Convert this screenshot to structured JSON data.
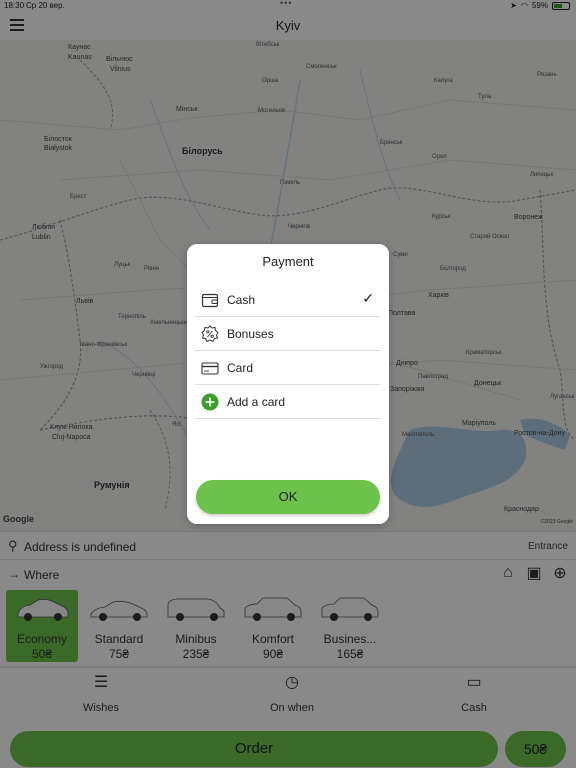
{
  "status_bar": {
    "time": "18:30",
    "date": "Ср 20 вер.",
    "battery": "59%"
  },
  "header": {
    "title": "Kyiv"
  },
  "map": {
    "labels": [
      {
        "t": "Каунас",
        "c": "mid"
      },
      {
        "t": "Kaunas",
        "c": "mid"
      },
      {
        "t": "Вільнюс",
        "c": "mid"
      },
      {
        "t": "Vilnius",
        "c": "mid"
      },
      {
        "t": "Вітебськ",
        "c": ""
      },
      {
        "t": "Смоленськ",
        "c": ""
      },
      {
        "t": "Калуга",
        "c": ""
      },
      {
        "t": "Рязань",
        "c": ""
      },
      {
        "t": "Орша",
        "c": ""
      },
      {
        "t": "Тула",
        "c": ""
      },
      {
        "t": "Мінськ",
        "c": "mid"
      },
      {
        "t": "Могильов",
        "c": ""
      },
      {
        "t": "Брянськ",
        "c": ""
      },
      {
        "t": "Білосток",
        "c": "mid"
      },
      {
        "t": "Białystok",
        "c": "mid"
      },
      {
        "t": "Білорусь",
        "c": "big"
      },
      {
        "t": "Орел",
        "c": ""
      },
      {
        "t": "Липецьк",
        "c": ""
      },
      {
        "t": "Гомель",
        "c": ""
      },
      {
        "t": "Брест",
        "c": ""
      },
      {
        "t": "Курськ",
        "c": ""
      },
      {
        "t": "Воронеж",
        "c": "mid"
      },
      {
        "t": "Люблін",
        "c": "mid"
      },
      {
        "t": "Lublin",
        "c": "mid"
      },
      {
        "t": "Чернігів",
        "c": ""
      },
      {
        "t": "Старий Оскол",
        "c": ""
      },
      {
        "t": "Суми",
        "c": ""
      },
      {
        "t": "Бєлгород",
        "c": ""
      },
      {
        "t": "Харків",
        "c": "mid"
      },
      {
        "t": "Луцьк",
        "c": ""
      },
      {
        "t": "Рівне",
        "c": ""
      },
      {
        "t": "Львів",
        "c": "mid"
      },
      {
        "t": "Полтава",
        "c": "mid"
      },
      {
        "t": "Тернопіль",
        "c": ""
      },
      {
        "t": "Хмельницький",
        "c": ""
      },
      {
        "t": "Краматорськ",
        "c": ""
      },
      {
        "t": "Дніпро",
        "c": "mid"
      },
      {
        "t": "Донецьк",
        "c": "mid"
      },
      {
        "t": "Запоріжжя",
        "c": "mid"
      },
      {
        "t": "Павлоград",
        "c": ""
      },
      {
        "t": "Луганськ",
        "c": ""
      },
      {
        "t": "Клуж-Напока",
        "c": "mid"
      },
      {
        "t": "Cluj-Napoca",
        "c": "mid"
      },
      {
        "t": "Маріуполь",
        "c": "mid"
      },
      {
        "t": "Ростов-на-Дону",
        "c": "mid"
      },
      {
        "t": "Мелітополь",
        "c": ""
      },
      {
        "t": "Румунія",
        "c": "big"
      },
      {
        "t": "Краснодар",
        "c": "mid"
      },
      {
        "t": "Ужгород",
        "c": ""
      },
      {
        "t": "Чернівці",
        "c": ""
      },
      {
        "t": "Івано-Франківськ",
        "c": ""
      },
      {
        "t": "Ясі",
        "c": ""
      }
    ],
    "google": "Google",
    "copyright": "©2023 Google"
  },
  "address": {
    "from": "Address is undefined",
    "entrance": "Entrance",
    "to": "Where"
  },
  "car_classes": [
    {
      "name": "Economy",
      "price": "50₴",
      "selected": true
    },
    {
      "name": "Standard",
      "price": "75₴",
      "selected": false
    },
    {
      "name": "Minibus",
      "price": "235₴",
      "selected": false
    },
    {
      "name": "Komfort",
      "price": "90₴",
      "selected": false
    },
    {
      "name": "Busines...",
      "price": "165₴",
      "selected": false
    }
  ],
  "options": {
    "wishes": "Wishes",
    "on_when": "On when",
    "payment": "Cash"
  },
  "order": {
    "label": "Order",
    "price": "50₴"
  },
  "dialog": {
    "title": "Payment",
    "items": [
      {
        "label": "Cash",
        "icon": "wallet-icon",
        "checked": true
      },
      {
        "label": "Bonuses",
        "icon": "bonus-percent-icon",
        "checked": false
      },
      {
        "label": "Card",
        "icon": "credit-card-icon",
        "checked": false
      },
      {
        "label": "Add a card",
        "icon": "add-circle-icon",
        "checked": false
      }
    ],
    "ok": "OK",
    "accent": "#6cc24a"
  }
}
